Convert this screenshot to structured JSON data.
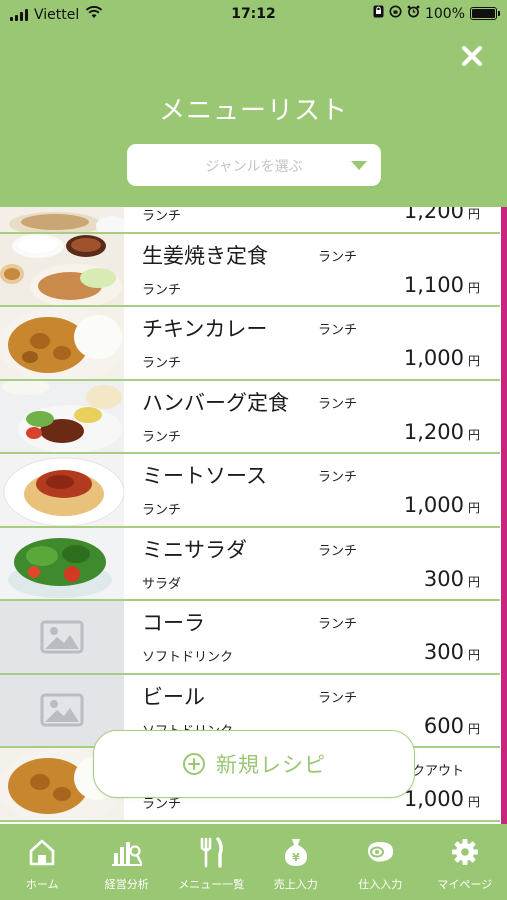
{
  "status_bar": {
    "carrier": "Viettel",
    "time": "17:12",
    "battery_level": "100%",
    "icons": [
      "signal-icon",
      "wifi-icon",
      "portrait-lock-icon",
      "alarm-icon",
      "battery-icon"
    ]
  },
  "header": {
    "title": "メニューリスト",
    "genre_placeholder": "ジャンルを選ぶ",
    "close_icon": "close-icon"
  },
  "colors": {
    "brand_green": "#9ac774",
    "divider_green": "#a6cd82",
    "accent_magenta": "#c7257f",
    "placeholder_gray": "#c4c4c4"
  },
  "currency_unit": "円",
  "menu_items": [
    {
      "name": "",
      "tag": "",
      "category": "ランチ",
      "price": "1,200",
      "image": "dish-partial-photo"
    },
    {
      "name": "生姜焼き定食",
      "tag": "ランチ",
      "category": "ランチ",
      "price": "1,100",
      "image": "ginger-pork-set-photo"
    },
    {
      "name": "チキンカレー",
      "tag": "ランチ",
      "category": "ランチ",
      "price": "1,000",
      "image": "chicken-curry-photo"
    },
    {
      "name": "ハンバーグ定食",
      "tag": "ランチ",
      "category": "ランチ",
      "price": "1,200",
      "image": "hamburg-steak-set-photo"
    },
    {
      "name": "ミートソース",
      "tag": "ランチ",
      "category": "ランチ",
      "price": "1,000",
      "image": "meat-sauce-pasta-photo"
    },
    {
      "name": "ミニサラダ",
      "tag": "ランチ",
      "category": "サラダ",
      "price": "300",
      "image": "mini-salad-photo"
    },
    {
      "name": "コーラ",
      "tag": "ランチ",
      "category": "ソフトドリンク",
      "price": "300",
      "image": "image-placeholder-icon"
    },
    {
      "name": "ビール",
      "tag": "ランチ",
      "category": "ソフトドリンク",
      "price": "600",
      "image": "image-placeholder-icon"
    },
    {
      "name": "",
      "tag": "クアウト",
      "category": "ランチ",
      "price": "1,000",
      "image": "chicken-curry-photo"
    }
  ],
  "new_recipe_button": {
    "label": "新規レシピ",
    "icon": "plus-circle-icon"
  },
  "tabbar": {
    "tabs": [
      {
        "label": "ホーム",
        "icon": "home-icon"
      },
      {
        "label": "経営分析",
        "icon": "analytics-icon"
      },
      {
        "label": "メニュー一覧",
        "icon": "fork-knife-icon"
      },
      {
        "label": "売上入力",
        "icon": "yen-bag-icon"
      },
      {
        "label": "仕入入力",
        "icon": "meat-icon"
      },
      {
        "label": "マイページ",
        "icon": "gear-icon"
      }
    ]
  }
}
